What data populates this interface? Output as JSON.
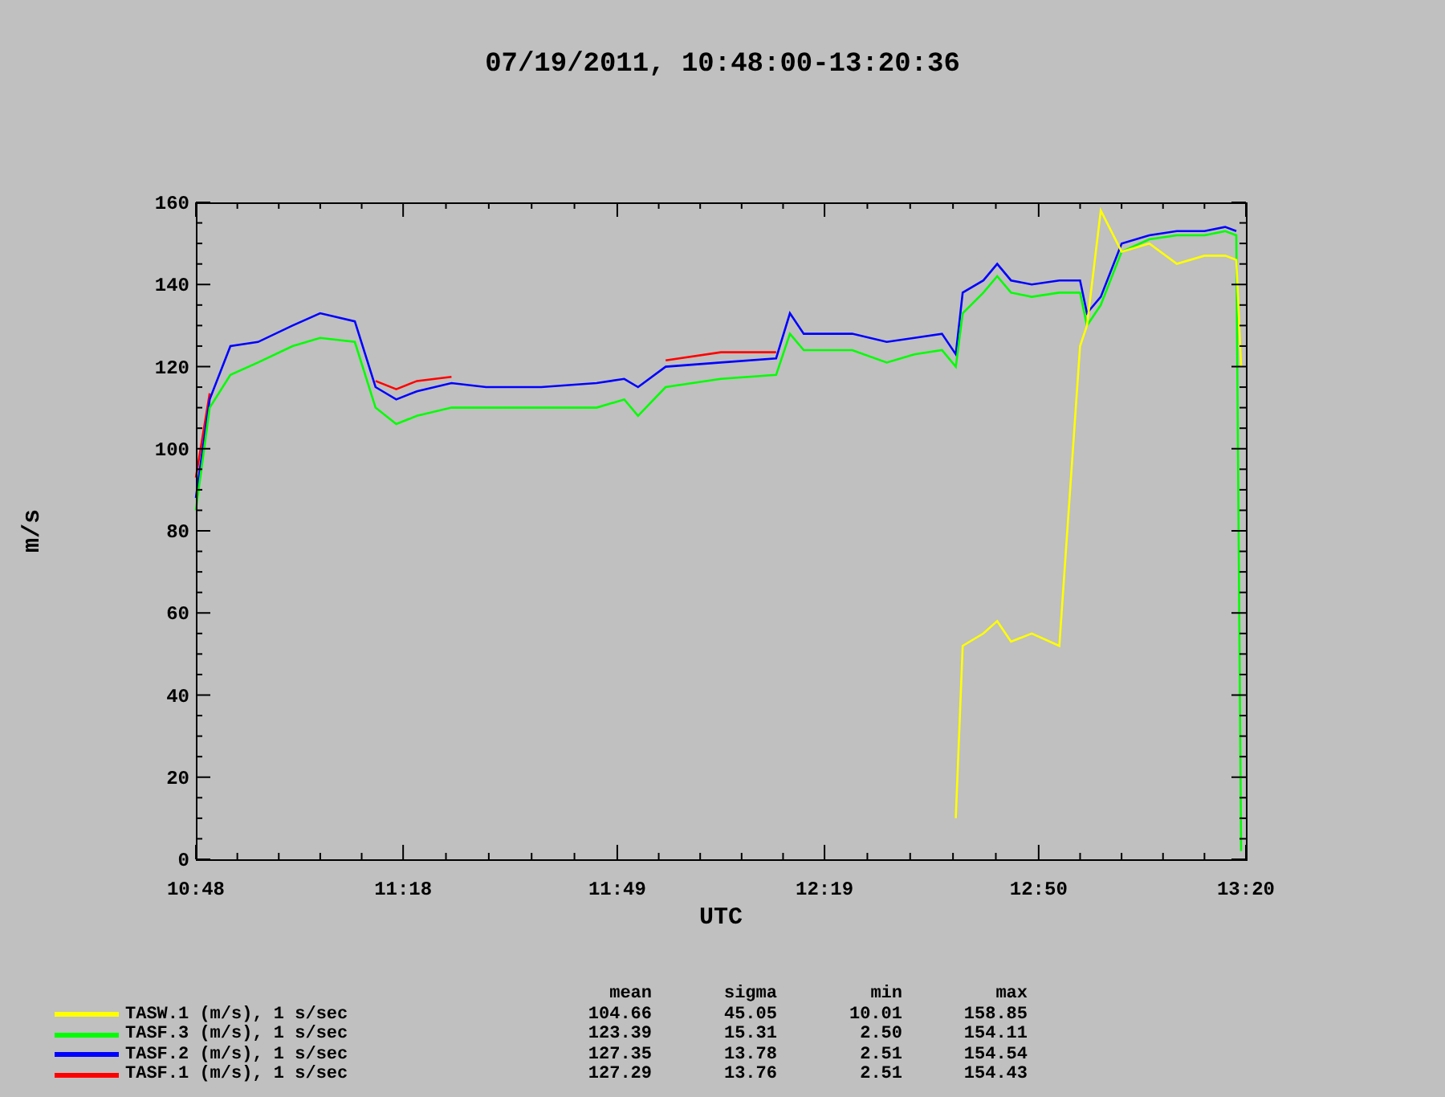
{
  "title": "07/19/2011, 10:48:00-13:20:36",
  "chart": {
    "chart_data": {
      "type": "line",
      "xlabel": "UTC",
      "ylabel": "m/s",
      "xlim": [
        648,
        800
      ],
      "ylim": [
        0,
        160
      ],
      "xticks": [
        {
          "value": 648,
          "label": "10:48"
        },
        {
          "value": 678,
          "label": "11:18"
        },
        {
          "value": 709,
          "label": "11:49"
        },
        {
          "value": 739,
          "label": "12:19"
        },
        {
          "value": 770,
          "label": "12:50"
        },
        {
          "value": 800,
          "label": "13:20"
        }
      ],
      "yticks": [
        0,
        20,
        40,
        60,
        80,
        100,
        120,
        140,
        160
      ],
      "x": [
        648,
        650,
        653,
        657,
        662,
        666,
        671,
        674,
        677,
        680,
        685,
        690,
        698,
        706,
        710,
        712,
        716,
        724,
        732,
        734,
        736,
        743,
        748,
        752,
        756,
        758,
        759,
        762,
        764,
        766,
        769,
        773,
        776,
        777,
        779,
        782,
        786,
        790,
        794,
        797,
        798.6,
        799.3
      ],
      "series": [
        {
          "name": "TASW.1 (m/s), 1 s/sec",
          "color": "#ffff00",
          "values": [
            null,
            null,
            null,
            null,
            null,
            null,
            null,
            null,
            null,
            null,
            null,
            null,
            null,
            null,
            null,
            null,
            null,
            null,
            null,
            null,
            null,
            null,
            null,
            null,
            null,
            10,
            52,
            55,
            58,
            53,
            55,
            52,
            125,
            130,
            158,
            148,
            150,
            145,
            147,
            147,
            146,
            120
          ]
        },
        {
          "name": "TASF.3 (m/s), 1 s/sec",
          "color": "#00ff00",
          "values": [
            85,
            110,
            118,
            121,
            125,
            127,
            126,
            110,
            106,
            108,
            110,
            110,
            110,
            110,
            112,
            108,
            115,
            117,
            118,
            128,
            124,
            124,
            121,
            123,
            124,
            120,
            133,
            138,
            142,
            138,
            137,
            138,
            138,
            130,
            135,
            148,
            151,
            152,
            152,
            153,
            152,
            2
          ]
        },
        {
          "name": "TASF.2 (m/s), 1 s/sec",
          "color": "#0000ff",
          "values": [
            88,
            112,
            125,
            126,
            130,
            133,
            131,
            115,
            112,
            114,
            116,
            115,
            115,
            116,
            117,
            115,
            120,
            121,
            122,
            133,
            128,
            128,
            126,
            127,
            128,
            123,
            138,
            141,
            145,
            141,
            140,
            141,
            141,
            133,
            137,
            150,
            152,
            153,
            153,
            154,
            153,
            null
          ]
        },
        {
          "name": "TASF.1 (m/s), 1 s/sec",
          "color": "#ff0000",
          "values": [
            93,
            113.5,
            null,
            null,
            null,
            null,
            null,
            116.5,
            114.5,
            116.5,
            117.5,
            null,
            null,
            null,
            null,
            null,
            121.5,
            123.5,
            123.5,
            null,
            null,
            null,
            null,
            null,
            null,
            null,
            null,
            null,
            null,
            null,
            null,
            null,
            null,
            null,
            null,
            null,
            null,
            null,
            null,
            null,
            null,
            null
          ]
        }
      ]
    }
  },
  "legend": {
    "columns": [
      "mean",
      "sigma",
      "min",
      "max"
    ],
    "rows": [
      {
        "stats": [
          "104.66",
          "45.05",
          "10.01",
          "158.85"
        ]
      },
      {
        "stats": [
          "123.39",
          "15.31",
          "2.50",
          "154.11"
        ]
      },
      {
        "stats": [
          "127.35",
          "13.78",
          "2.51",
          "154.54"
        ]
      },
      {
        "stats": [
          "127.29",
          "13.76",
          "2.51",
          "154.43"
        ]
      }
    ]
  }
}
